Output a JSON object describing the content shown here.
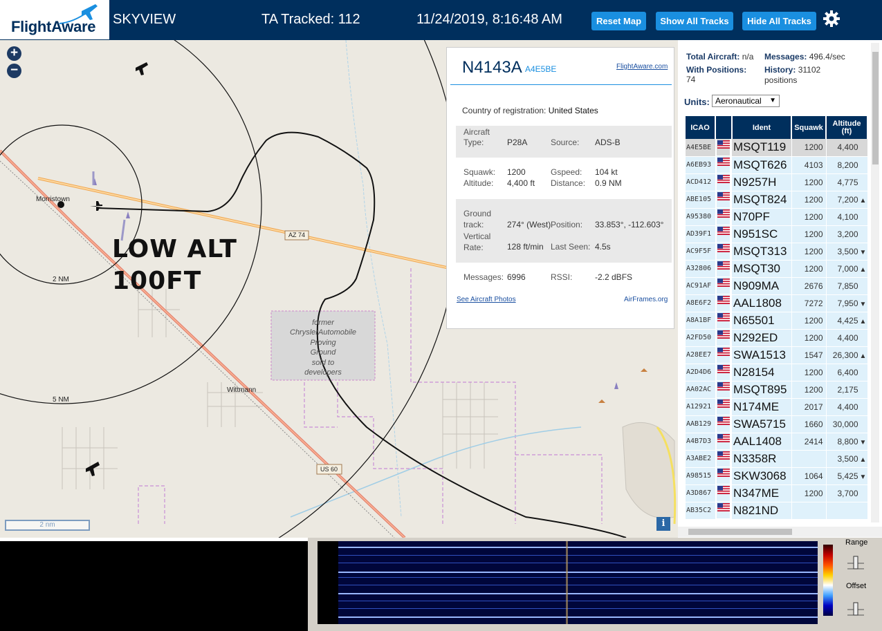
{
  "header": {
    "logo_text": "FlightAware",
    "app_title": "SKYVIEW",
    "ta_tracked": "TA Tracked: 112",
    "datetime": "11/24/2019, 8:16:48 AM",
    "buttons": {
      "reset_map": "Reset Map",
      "show_all_tracks": "Show All Tracks",
      "hide_all_tracks": "Hide All Tracks"
    },
    "settings_icon": "gear-icon",
    "brand_color": "#002f5d",
    "button_color": "#1a8fe0"
  },
  "map": {
    "zoom_in": "+",
    "zoom_out": "−",
    "labels": {
      "morristown": "Morristown",
      "ring_2nm": "2 NM",
      "ring_5nm": "5 NM",
      "az74": "AZ 74",
      "us60": "US 60",
      "wittmann": "Wittmann",
      "proving_ground": [
        "former",
        "ChryslerAutomobile",
        "Proving",
        "Ground",
        "sold to",
        "developers"
      ]
    },
    "overlay_text": [
      "LOW ALT",
      "100FT"
    ],
    "scale_label": "2 nm",
    "info_button": "i"
  },
  "popup": {
    "callsign": "N4143A",
    "icao": "A4E5BE",
    "fa_link": "FlightAware.com",
    "country_label": "Country of registration:",
    "country": "United States",
    "aircraft_type_label": "Aircraft Type:",
    "aircraft_type": "P28A",
    "source_label": "Source:",
    "source": "ADS-B",
    "squawk_label": "Squawk:",
    "squawk": "1200",
    "altitude_label": "Altitude:",
    "altitude": "4,400 ft",
    "gspeed_label": "Gspeed:",
    "gspeed": "104 kt",
    "distance_label": "Distance:",
    "distance": "0.9 NM",
    "ground_track_label": "Ground track:",
    "ground_track": "274° (West)",
    "position_label": "Position:",
    "position": "33.853°, -112.603°",
    "vertical_rate_label": "Vertical Rate:",
    "vertical_rate": "128 ft/min",
    "last_seen_label": "Last Seen:",
    "last_seen": "4.5s",
    "messages_label": "Messages:",
    "messages": "6996",
    "rssi_label": "RSSI:",
    "rssi": "-2.2 dBFS",
    "photos_link": "See Aircraft Photos",
    "airframes_link": "AirFrames.org"
  },
  "panel": {
    "total_aircraft_label": "Total Aircraft:",
    "total_aircraft": "n/a",
    "messages_label": "Messages:",
    "messages": "496.4/sec",
    "with_positions_label": "With Positions:",
    "with_positions": "74",
    "history_label": "History:",
    "history": "31102",
    "history_unit": "positions",
    "units_label": "Units:",
    "units_value": "Aeronautical",
    "columns": {
      "icao": "ICAO",
      "ident": "Ident",
      "squawk": "Squawk",
      "altitude": "Altitude (ft)"
    },
    "rows": [
      {
        "icao": "A4E5BE",
        "ident": "MSQT119",
        "squawk": "1200",
        "alt": "4,400",
        "trend": ""
      },
      {
        "icao": "A6EB93",
        "ident": "MSQT626",
        "squawk": "4103",
        "alt": "8,200",
        "trend": ""
      },
      {
        "icao": "ACD412",
        "ident": "N9257H",
        "squawk": "1200",
        "alt": "4,775",
        "trend": ""
      },
      {
        "icao": "ABE105",
        "ident": "MSQT824",
        "squawk": "1200",
        "alt": "7,200",
        "trend": "▲"
      },
      {
        "icao": "A95380",
        "ident": "N70PF",
        "squawk": "1200",
        "alt": "4,100",
        "trend": ""
      },
      {
        "icao": "AD39F1",
        "ident": "N951SC",
        "squawk": "1200",
        "alt": "3,200",
        "trend": ""
      },
      {
        "icao": "AC9F5F",
        "ident": "MSQT313",
        "squawk": "1200",
        "alt": "3,500",
        "trend": "▼"
      },
      {
        "icao": "A32806",
        "ident": "MSQT30",
        "squawk": "1200",
        "alt": "7,000",
        "trend": "▲"
      },
      {
        "icao": "AC91AF",
        "ident": "N909MA",
        "squawk": "2676",
        "alt": "7,850",
        "trend": ""
      },
      {
        "icao": "A8E6F2",
        "ident": "AAL1808",
        "squawk": "7272",
        "alt": "7,950",
        "trend": "▼"
      },
      {
        "icao": "A8A1BF",
        "ident": "N65501",
        "squawk": "1200",
        "alt": "4,425",
        "trend": "▲"
      },
      {
        "icao": "A2FD50",
        "ident": "N292ED",
        "squawk": "1200",
        "alt": "4,400",
        "trend": ""
      },
      {
        "icao": "A28EE7",
        "ident": "SWA1513",
        "squawk": "1547",
        "alt": "26,300",
        "trend": "▲"
      },
      {
        "icao": "A2D4D6",
        "ident": "N28154",
        "squawk": "1200",
        "alt": "6,400",
        "trend": ""
      },
      {
        "icao": "AA02AC",
        "ident": "MSQT895",
        "squawk": "1200",
        "alt": "2,175",
        "trend": ""
      },
      {
        "icao": "A12921",
        "ident": "N174ME",
        "squawk": "2017",
        "alt": "4,400",
        "trend": ""
      },
      {
        "icao": "AAB129",
        "ident": "SWA5715",
        "squawk": "1660",
        "alt": "30,000",
        "trend": ""
      },
      {
        "icao": "A4B7D3",
        "ident": "AAL1408",
        "squawk": "2414",
        "alt": "8,800",
        "trend": "▼"
      },
      {
        "icao": "A3ABE2",
        "ident": "N3358R",
        "squawk": "",
        "alt": "3,500",
        "trend": "▲"
      },
      {
        "icao": "A98515",
        "ident": "SKW3068",
        "squawk": "1064",
        "alt": "5,425",
        "trend": "▼"
      },
      {
        "icao": "A3D867",
        "ident": "N347ME",
        "squawk": "1200",
        "alt": "3,700",
        "trend": ""
      },
      {
        "icao": "AB35C2",
        "ident": "N821ND",
        "squawk": "",
        "alt": "",
        "trend": ""
      }
    ]
  },
  "spectrum": {
    "range_label": "Range",
    "offset_label": "Offset"
  }
}
